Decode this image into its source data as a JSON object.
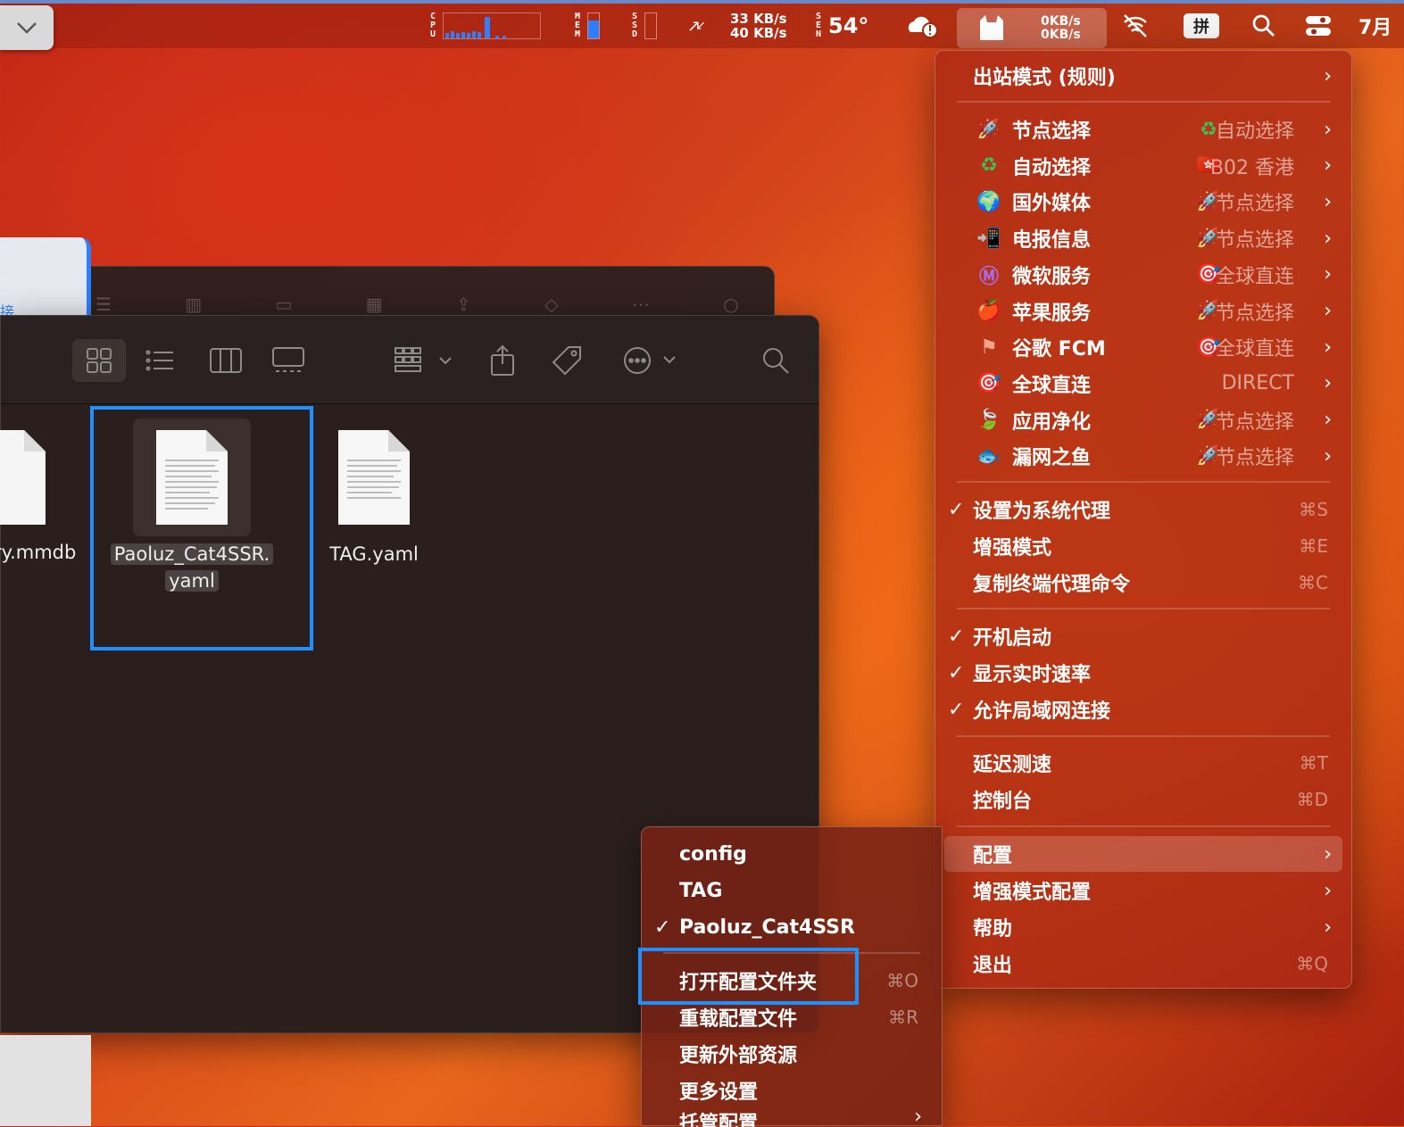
{
  "menubar": {
    "cpu_label": "CPU",
    "mem_label": "MEM",
    "ssd_label": "SSD",
    "mem_level": 0.7,
    "ssd_level": 0.0,
    "net_up": "33 KB/s",
    "net_down": "40 KB/s",
    "sen_label": "SEN",
    "temperature": "54°",
    "clash_up": "0KB/s",
    "clash_down": "0KB/s",
    "input_method": "拼",
    "clock": "7月"
  },
  "finder": {
    "files": [
      {
        "name": "ry.mmdb"
      },
      {
        "name_line1": "Paoluz_Cat4SSR.",
        "name_line2": "yaml"
      },
      {
        "name": "TAG.yaml"
      }
    ],
    "back_tab_label": "接"
  },
  "main_menu": {
    "outbound_mode": "出站模式 (规则)",
    "groups": [
      {
        "icon": "rocket",
        "name": "节点选择",
        "value_icon": "recycle",
        "value": "自动选择"
      },
      {
        "icon": "recycle",
        "name": "自动选择",
        "value_icon": "hk-flag",
        "value": "B02 香港"
      },
      {
        "icon": "globe",
        "name": "国外媒体",
        "value_icon": "rocket",
        "value": "节点选择"
      },
      {
        "icon": "telegram",
        "name": "电报信息",
        "value_icon": "rocket",
        "value": "节点选择"
      },
      {
        "icon": "microsoft",
        "name": "微软服务",
        "value_icon": "target",
        "value": "全球直连"
      },
      {
        "icon": "apple",
        "name": "苹果服务",
        "value_icon": "rocket",
        "value": "节点选择"
      },
      {
        "icon": "flag",
        "name": "谷歌 FCM",
        "value_icon": "target",
        "value": "全球直连"
      },
      {
        "icon": "target",
        "name": "全球直连",
        "value_icon": "",
        "value": "DIRECT"
      },
      {
        "icon": "clean",
        "name": "应用净化",
        "value_icon": "rocket",
        "value": "节点选择"
      },
      {
        "icon": "fish",
        "name": "漏网之鱼",
        "value_icon": "rocket",
        "value": "节点选择"
      }
    ],
    "system_proxy": {
      "label": "设置为系统代理",
      "shortcut": "⌘S",
      "checked": true
    },
    "enhanced_mode": {
      "label": "增强模式",
      "shortcut": "⌘E"
    },
    "copy_cmd": {
      "label": "复制终端代理命令",
      "shortcut": "⌘C"
    },
    "launch_at_login": {
      "label": "开机启动",
      "checked": true
    },
    "show_speed": {
      "label": "显示实时速率",
      "checked": true
    },
    "allow_lan": {
      "label": "允许局域网连接",
      "checked": true
    },
    "latency_test": {
      "label": "延迟测速",
      "shortcut": "⌘T"
    },
    "dashboard": {
      "label": "控制台",
      "shortcut": "⌘D"
    },
    "config": {
      "label": "配置"
    },
    "enhanced_config": {
      "label": "增强模式配置"
    },
    "help": {
      "label": "帮助"
    },
    "quit": {
      "label": "退出",
      "shortcut": "⌘Q"
    }
  },
  "config_submenu": {
    "profiles": [
      {
        "name": "config",
        "checked": false
      },
      {
        "name": "TAG",
        "checked": false
      },
      {
        "name": "Paoluz_Cat4SSR",
        "checked": true
      }
    ],
    "open_folder": {
      "label": "打开配置文件夹",
      "shortcut": "⌘O"
    },
    "reload": {
      "label": "重载配置文件",
      "shortcut": "⌘R"
    },
    "update_external": {
      "label": "更新外部资源"
    },
    "more_settings": {
      "label": "更多设置"
    },
    "hosted_config": {
      "label": "托管配置"
    }
  },
  "colors": {
    "accent": "#1e90ff",
    "menu_bg": "#aa2814",
    "desktop": "#d2401a"
  }
}
